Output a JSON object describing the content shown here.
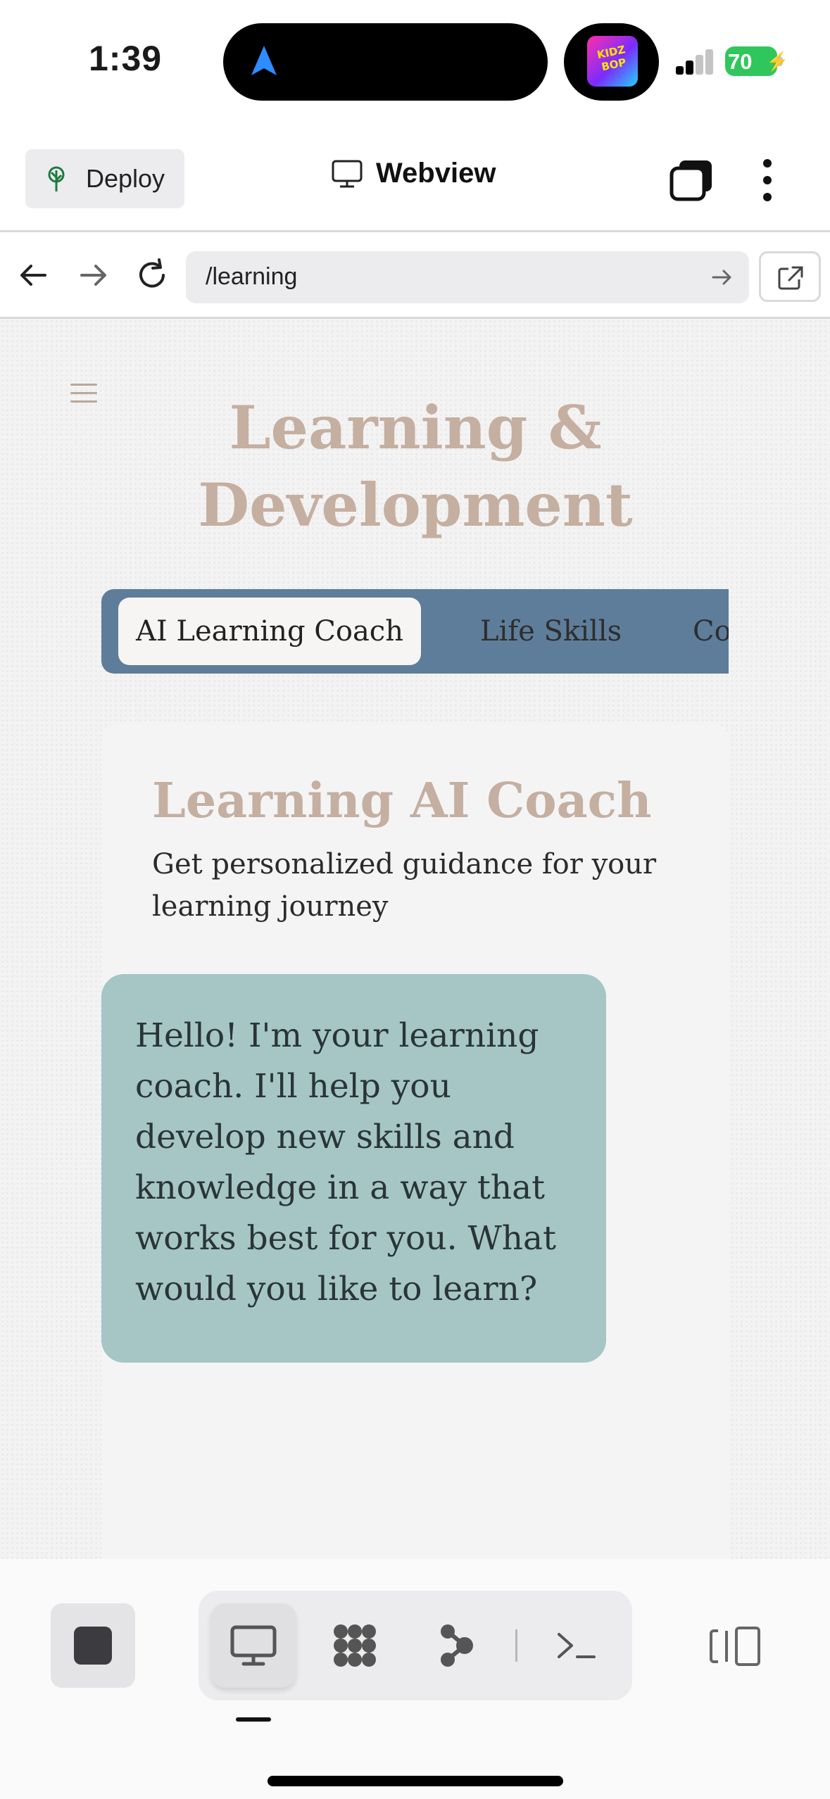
{
  "status_bar": {
    "time": "1:39",
    "battery_percent": "70",
    "battery_charging": true,
    "signal_bars": 2,
    "live_activity_app": "KIDZ BOP"
  },
  "toolbar": {
    "deploy_label": "Deploy",
    "title": "Webview",
    "icons": [
      "deploy-tree-icon",
      "monitor-icon",
      "tabs-icon",
      "more-vertical-icon"
    ]
  },
  "url_bar": {
    "url": "/learning",
    "icons": [
      "back-arrow-icon",
      "forward-arrow-icon",
      "reload-icon",
      "go-arrow-icon",
      "open-external-icon"
    ]
  },
  "page": {
    "title": "Learning & Development",
    "tabs": [
      {
        "label": "AI Learning Coach",
        "active": true
      },
      {
        "label": "Life Skills",
        "active": false
      },
      {
        "label": "Co",
        "active": false
      }
    ],
    "card": {
      "title": "Learning AI Coach",
      "subtitle": "Get personalized guidance for your learning journey",
      "message": "Hello! I'm your learning coach. I'll help you develop new skills and knowledge in a way that works best for you. What would you like to learn?"
    }
  },
  "bottom_bar": {
    "tools": [
      "webview-tool",
      "apps-tool",
      "agent-tool",
      "shell-tool"
    ],
    "selected_tool": "webview-tool"
  },
  "colors": {
    "accent_title": "#c4afa1",
    "tab_bar": "#5e7d9a",
    "chat_bubble": "#a5c6c5",
    "battery": "#2fc75b"
  }
}
